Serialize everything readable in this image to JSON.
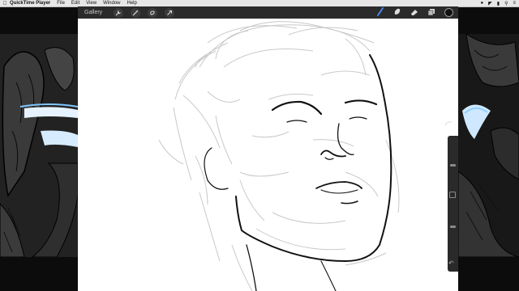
{
  "menubar": {
    "apple_icon": "apple-icon",
    "app_name": "QuickTime Player",
    "menus": [
      "File",
      "Edit",
      "View",
      "Window",
      "Help"
    ]
  },
  "toolbar": {
    "gallery_label": "Gallery",
    "tools_left": [
      "wrench-icon",
      "magic-wand-icon",
      "selection-icon",
      "transform-arrow-icon"
    ],
    "tools_right": [
      "brush-icon",
      "smudge-icon",
      "eraser-icon",
      "layers-icon"
    ],
    "active_tool": "brush-icon",
    "active_color": "#4a86e8",
    "current_color": "#111111"
  },
  "colors": {
    "menubar_bg": "#e6e6e6",
    "toolbar_bg": "#2b2b2b",
    "canvas_bg": "#ffffff",
    "frame_bg": "#0c0c0c"
  },
  "sidebar": {
    "brush_size_level": 0.55,
    "opacity_level": 0.45,
    "undo_icon": "undo-icon",
    "modify_icon": "square-modify-icon"
  }
}
